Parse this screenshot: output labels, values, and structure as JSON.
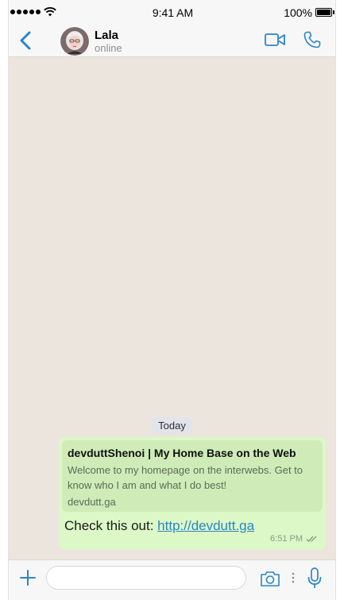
{
  "status_bar": {
    "time": "9:41 AM",
    "battery": "100%",
    "battery_level": 1.0
  },
  "header": {
    "contact_name": "Lala",
    "contact_status": "online"
  },
  "chat": {
    "date_label": "Today",
    "message": {
      "preview_title": "devduttShenoi | My Home Base on the Web",
      "preview_description": "Welcome to my homepage on the interwebs. Get to know who I am and what I do best!",
      "preview_domain": "devdutt.ga",
      "text_prefix": "Check this out: ",
      "link_text": "http://devdutt.ga",
      "time": "6:51 PM",
      "read_status": "double-check-icon"
    }
  },
  "input_bar": {
    "placeholder": ""
  },
  "colors": {
    "accent": "#2a85c8",
    "chat_background": "#ece5dd",
    "outgoing_bubble": "#dcf8c6",
    "preview_background": "#cfecb8"
  }
}
